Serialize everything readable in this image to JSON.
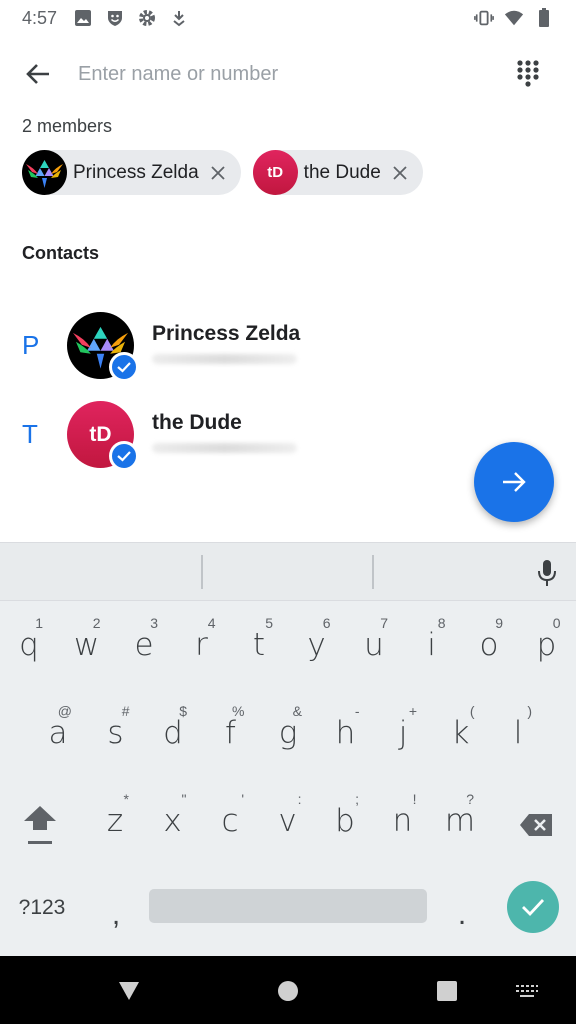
{
  "status_bar": {
    "time": "4:57",
    "left_icons": [
      "image-icon",
      "smiley-shield-icon",
      "gear-icon",
      "download-icon"
    ],
    "right_icons": [
      "vibrate-icon",
      "wifi-icon",
      "battery-icon"
    ]
  },
  "top_bar": {
    "search_placeholder": "Enter name or number",
    "search_value": ""
  },
  "members": {
    "label": "2 members",
    "chips": [
      {
        "label": "Princess Zelda",
        "avatar_type": "image"
      },
      {
        "label": "the Dude",
        "avatar_initials": "tD"
      }
    ]
  },
  "contacts": {
    "header": "Contacts",
    "items": [
      {
        "letter": "P",
        "name": "Princess Zelda",
        "selected": true,
        "avatar_type": "image"
      },
      {
        "letter": "T",
        "name": "the Dude",
        "avatar_initials": "tD",
        "selected": true
      }
    ]
  },
  "keyboard": {
    "row1": [
      {
        "char": "q",
        "hint": "1"
      },
      {
        "char": "w",
        "hint": "2"
      },
      {
        "char": "e",
        "hint": "3"
      },
      {
        "char": "r",
        "hint": "4"
      },
      {
        "char": "t",
        "hint": "5"
      },
      {
        "char": "y",
        "hint": "6"
      },
      {
        "char": "u",
        "hint": "7"
      },
      {
        "char": "i",
        "hint": "8"
      },
      {
        "char": "o",
        "hint": "9"
      },
      {
        "char": "p",
        "hint": "0"
      }
    ],
    "row2": [
      {
        "char": "a",
        "hint": "@"
      },
      {
        "char": "s",
        "hint": "#"
      },
      {
        "char": "d",
        "hint": "$"
      },
      {
        "char": "f",
        "hint": "%"
      },
      {
        "char": "g",
        "hint": "&"
      },
      {
        "char": "h",
        "hint": "-"
      },
      {
        "char": "j",
        "hint": "+"
      },
      {
        "char": "k",
        "hint": "("
      },
      {
        "char": "l",
        "hint": ")"
      }
    ],
    "row3": [
      {
        "char": "z",
        "hint": "*"
      },
      {
        "char": "x",
        "hint": "\""
      },
      {
        "char": "c",
        "hint": "'"
      },
      {
        "char": "v",
        "hint": ":"
      },
      {
        "char": "b",
        "hint": ";"
      },
      {
        "char": "n",
        "hint": "!"
      },
      {
        "char": "m",
        "hint": "?"
      }
    ],
    "sym_label": "?123",
    "comma": ",",
    "period": ".",
    "enter_color": "#4db6ac"
  },
  "colors": {
    "accent": "#1a73e8",
    "td_avatar": "#d81b4a"
  }
}
